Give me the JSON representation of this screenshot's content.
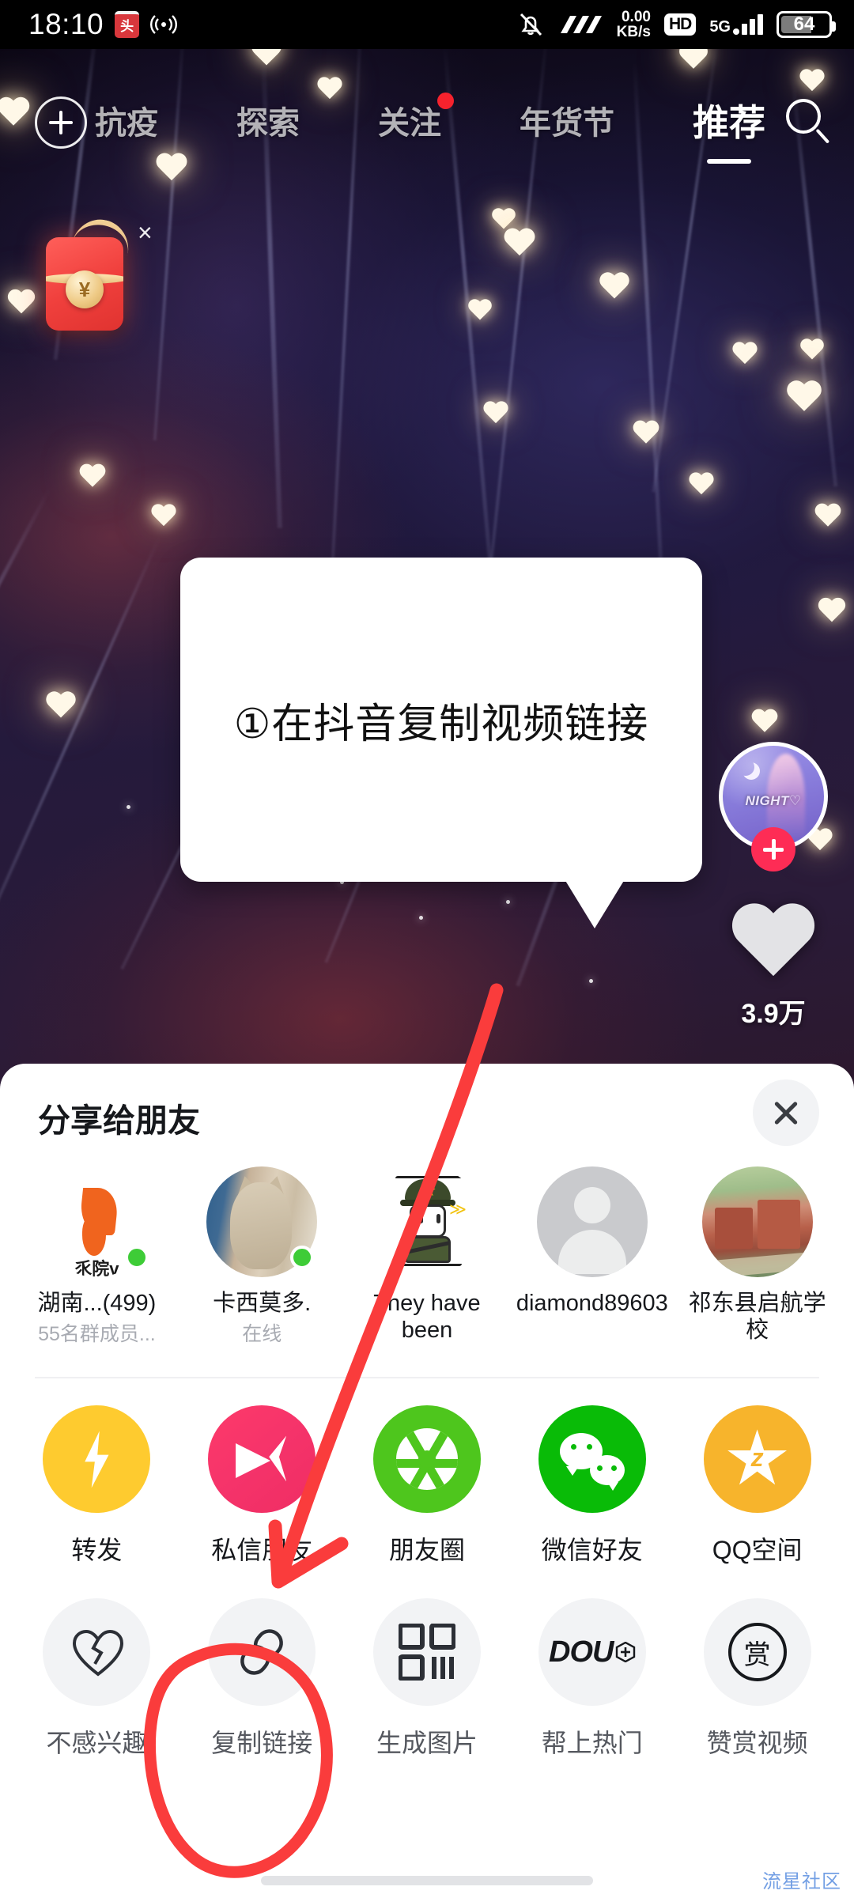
{
  "statusbar": {
    "time": "18:10",
    "app_badge": "头条",
    "broadcast_icon": "broadcast-icon",
    "mute_icon": "bell-off-icon",
    "carrier_icon": "carrier-logo-icon",
    "netspeed_value": "0.00",
    "netspeed_unit": "KB/s",
    "hd": "HD",
    "network": "5G",
    "battery": "64"
  },
  "topnav": {
    "plus_label": "add-icon",
    "items": [
      {
        "label": "抗疫",
        "active": false,
        "dot": false
      },
      {
        "label": "探索",
        "active": false,
        "dot": false
      },
      {
        "label": "关注",
        "active": false,
        "dot": true
      },
      {
        "label": "年货节",
        "active": false,
        "dot": false
      },
      {
        "label": "推荐",
        "active": true,
        "dot": false
      }
    ],
    "search_icon": "search-icon"
  },
  "redpacket": {
    "currency": "¥",
    "close_label": "×"
  },
  "right_rail": {
    "avatar_nick_art": "NIGHT♡",
    "follow_label": "follow-plus-icon",
    "like_count": "3.9万"
  },
  "callout": {
    "text": "①在抖音复制视频链接"
  },
  "sheet": {
    "title": "分享给朋友",
    "close_label": "close-icon",
    "friends": [
      {
        "name": "湖南...(499)",
        "sub": "55名群成员...",
        "avatar": "group-bird-avatar",
        "online": true,
        "badge_text": "乑院v"
      },
      {
        "name": "卡西莫多.",
        "sub": "在线",
        "avatar": "cat-photo-avatar",
        "online": true,
        "badge_text": ""
      },
      {
        "name": "They have been",
        "sub": "",
        "avatar": "soldier-cartoon-avatar",
        "online": false,
        "badge_text": ""
      },
      {
        "name": "diamond89603",
        "sub": "",
        "avatar": "default-person-avatar",
        "online": false,
        "badge_text": ""
      },
      {
        "name": "祁东县启航学校",
        "sub": "",
        "avatar": "school-photo-avatar",
        "online": false,
        "badge_text": ""
      }
    ],
    "actions_row1": [
      {
        "label": "转发",
        "icon": "lightning-bolt-icon",
        "color": "#fecb2f"
      },
      {
        "label": "私信朋友",
        "icon": "paper-plane-icon",
        "color": "#fd3a6a"
      },
      {
        "label": "朋友圈",
        "icon": "moments-aperture-icon",
        "color": "#4ec61d"
      },
      {
        "label": "微信好友",
        "icon": "wechat-icon",
        "color": "#09bb07"
      },
      {
        "label": "QQ空间",
        "icon": "qzone-star-icon",
        "color": "#f7b42c"
      }
    ],
    "actions_row2": [
      {
        "label": "不感兴趣",
        "icon": "broken-heart-icon",
        "color": "#f2f3f5"
      },
      {
        "label": "复制链接",
        "icon": "link-icon",
        "color": "#f2f3f5"
      },
      {
        "label": "生成图片",
        "icon": "qr-code-icon",
        "color": "#f2f3f5"
      },
      {
        "label": "帮上热门",
        "icon": "dou-plus-icon",
        "color": "#f2f3f5",
        "glyph_text": "DOU"
      },
      {
        "label": "赞赏视频",
        "icon": "reward-shang-icon",
        "color": "#f2f3f5",
        "glyph_text": "赏"
      }
    ],
    "watermark": "流星社区"
  },
  "annotations": {
    "arrow_color": "#fa3c3c",
    "circle_color": "#fa3c3c",
    "arrow_target": "私信朋友",
    "circle_target": "复制链接"
  }
}
